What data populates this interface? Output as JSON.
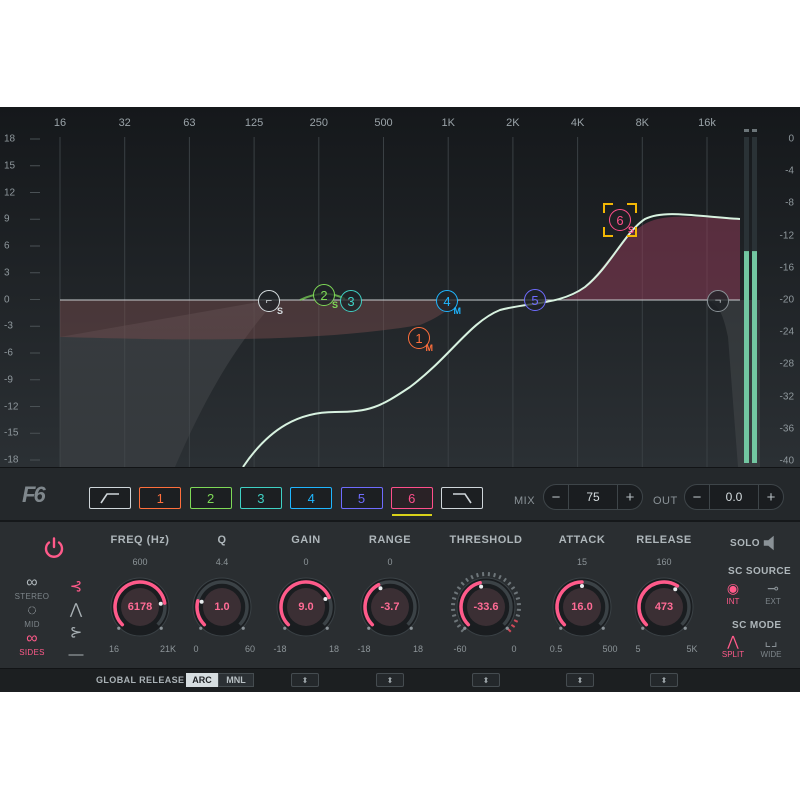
{
  "graph": {
    "freq_labels": [
      "16",
      "32",
      "63",
      "125",
      "250",
      "500",
      "1K",
      "2K",
      "4K",
      "8K",
      "16k"
    ],
    "gain_labels": [
      "18",
      "15",
      "12",
      "9",
      "6",
      "3",
      "0",
      "-3",
      "-6",
      "-9",
      "-12",
      "-15",
      "-18"
    ],
    "meter_labels": [
      "0",
      "-4",
      "-8",
      "-12",
      "-16",
      "-20",
      "-24",
      "-28",
      "-32",
      "-36",
      "-40"
    ],
    "nodes": [
      {
        "label": "1",
        "sub": "M",
        "color": "#ff6f3c"
      },
      {
        "label": "2",
        "sub": "S",
        "color": "#7ed957"
      },
      {
        "label": "3",
        "sub": "",
        "color": "#3fd1c4"
      },
      {
        "label": "4",
        "sub": "M",
        "color": "#1fb6ff"
      },
      {
        "label": "5",
        "sub": "",
        "color": "#6f6cff"
      },
      {
        "label": "6",
        "sub": "S",
        "color": "#ff4f8b"
      }
    ],
    "low_cut_sub": "S",
    "selected_band": "6",
    "meter_level_fraction": 0.65
  },
  "bandbar": {
    "logo": "F6",
    "bands": [
      {
        "label": "",
        "icon": "low-cut",
        "color": "#cfd6da"
      },
      {
        "label": "1",
        "color": "#ff6f3c"
      },
      {
        "label": "2",
        "color": "#7ed957"
      },
      {
        "label": "3",
        "color": "#3fd1c4"
      },
      {
        "label": "4",
        "color": "#1fb6ff"
      },
      {
        "label": "5",
        "color": "#6f6cff"
      },
      {
        "label": "6",
        "color": "#ff4f8b"
      },
      {
        "label": "",
        "icon": "high-cut",
        "color": "#cfd6da"
      }
    ],
    "mix": {
      "label": "MIX",
      "minus": "−",
      "plus": "+",
      "value": "75"
    },
    "out": {
      "label": "OUT",
      "minus": "−",
      "plus": "+",
      "value": "0.0"
    }
  },
  "panel": {
    "accent": "#ff5a8a",
    "modes": [
      {
        "label": "STEREO",
        "active": false
      },
      {
        "label": "MID",
        "active": false
      },
      {
        "label": "SIDES",
        "active": true
      }
    ],
    "knobs": [
      {
        "title": "FREQ (Hz)",
        "default": "600",
        "value": "6178",
        "min": "16",
        "max": "21K",
        "fraction": 0.8
      },
      {
        "title": "Q",
        "default": "4.4",
        "value": "1.0",
        "min": "0",
        "max": "60",
        "fraction": 0.22
      },
      {
        "title": "GAIN",
        "default": "0",
        "value": "9.0",
        "min": "-18",
        "max": "18",
        "fraction": 0.75
      },
      {
        "title": "RANGE",
        "default": "0",
        "value": "-3.7",
        "min": "-18",
        "max": "18",
        "fraction": 0.4
      },
      {
        "title": "THRESHOLD",
        "default": "",
        "value": "-33.6",
        "min": "-60",
        "max": "0",
        "fraction": 0.45
      },
      {
        "title": "ATTACK",
        "default": "15",
        "value": "16.0",
        "min": "0.5",
        "max": "500",
        "fraction": 0.5
      },
      {
        "title": "RELEASE",
        "default": "160",
        "value": "473",
        "min": "5",
        "max": "5K",
        "fraction": 0.62
      }
    ],
    "solo_label": "SOLO",
    "sc_source": {
      "title": "SC SOURCE",
      "int": "INT",
      "ext": "EXT",
      "active": "INT"
    },
    "sc_mode": {
      "title": "SC MODE",
      "split": "SPLIT",
      "wide": "WIDE",
      "active": "SPLIT"
    }
  },
  "bottom": {
    "global_release_label": "GLOBAL RELEASE",
    "arc": "ARC",
    "mnl": "MNL",
    "active": "ARC"
  }
}
